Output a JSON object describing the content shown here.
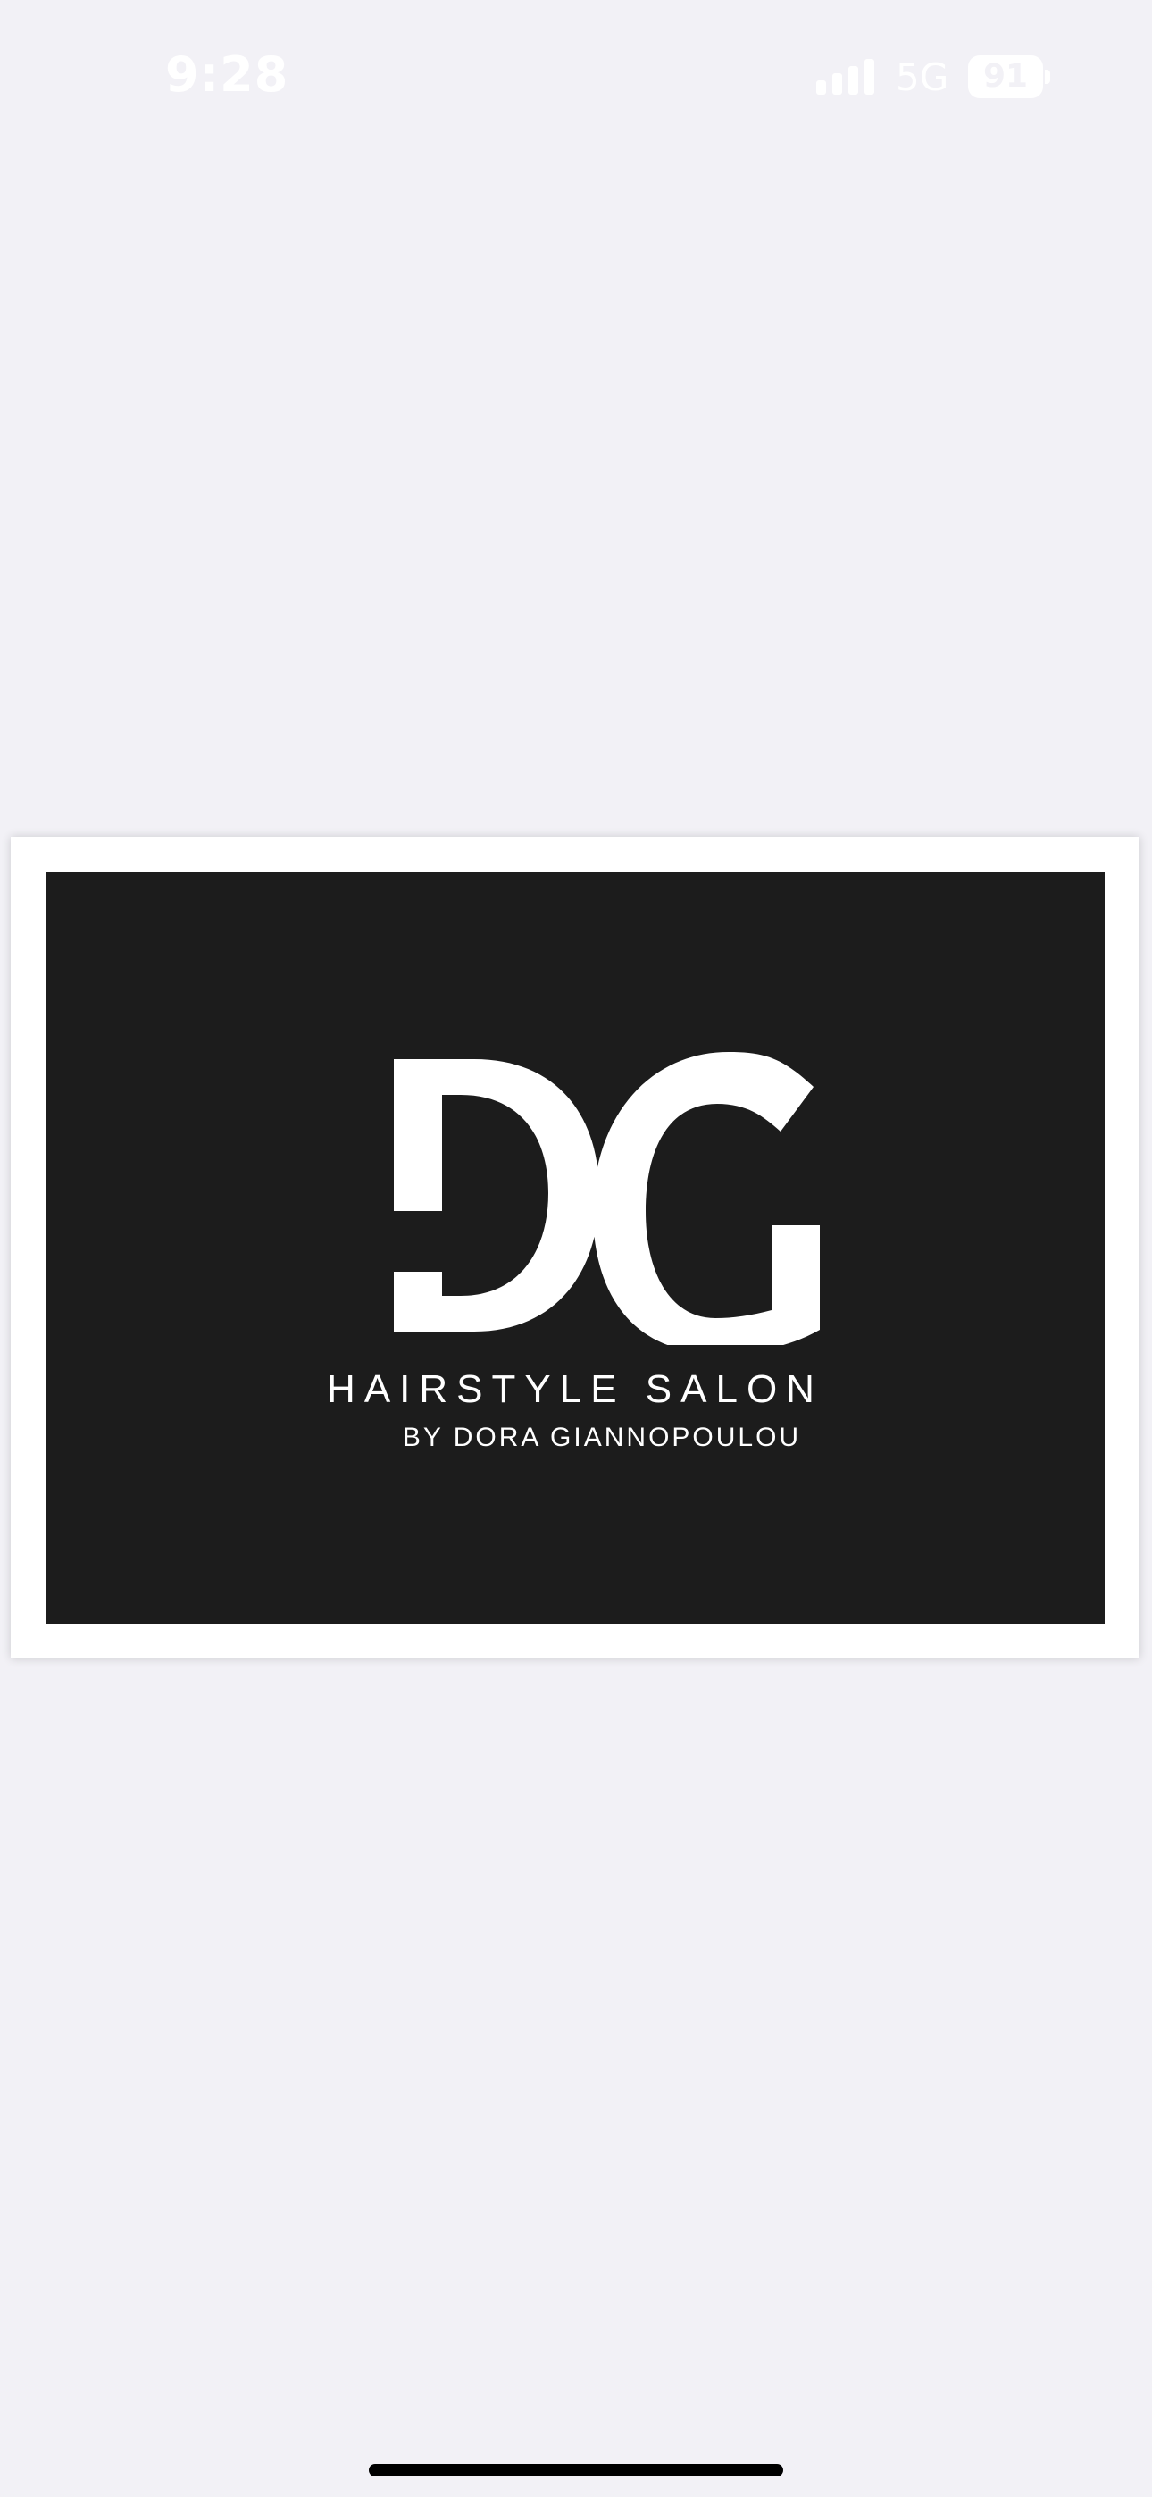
{
  "status_bar": {
    "time": "9:28",
    "network": "5G",
    "battery": "91"
  },
  "card": {
    "monogram": "DG",
    "title": "HAIRSTYLE SALON",
    "subtitle": "BY DORA GIANNOPOULOU"
  },
  "colors": {
    "background": "#f2f1f6",
    "card_border": "#ffffff",
    "card_fill": "#1c1c1c",
    "logo_text": "#ffffff"
  }
}
